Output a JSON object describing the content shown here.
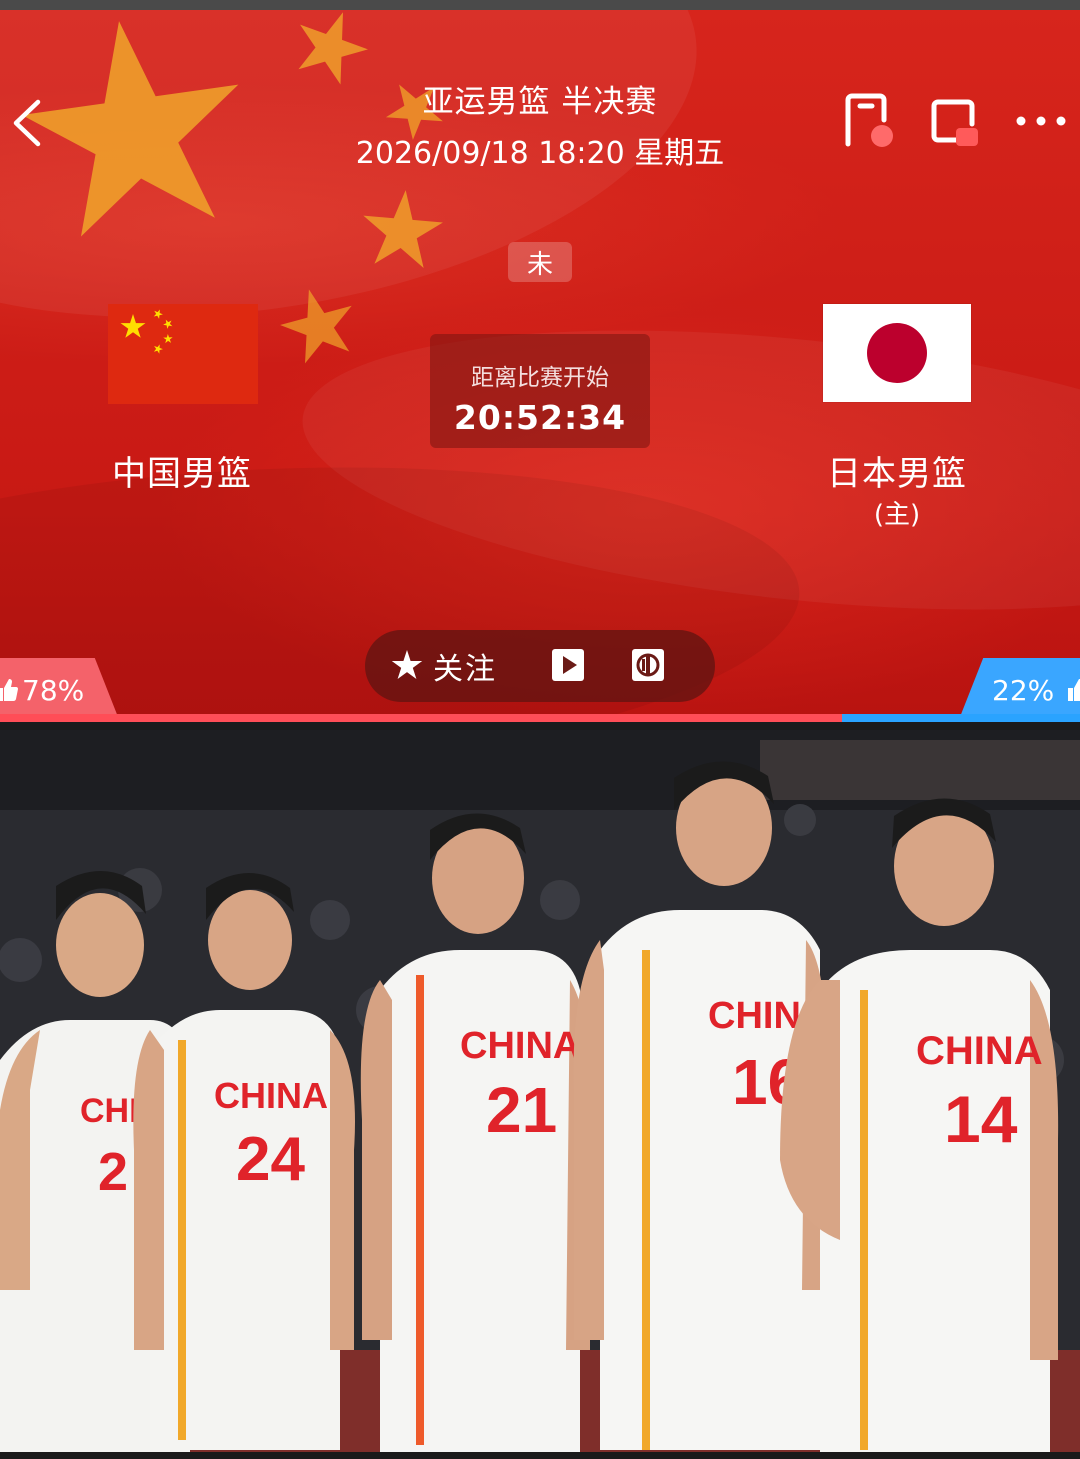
{
  "header": {
    "title": "亚运男篮 半决赛",
    "datetime": "2026/09/18 18:20 星期五",
    "status_badge": "未",
    "countdown_label": "距离比赛开始",
    "countdown_value": "20:52:34"
  },
  "teams": {
    "home": {
      "name": "中国男篮",
      "flag": "china-flag"
    },
    "away": {
      "name": "日本男篮",
      "tag": "(主)",
      "flag": "japan-flag"
    }
  },
  "actions": {
    "follow_label": "关注",
    "follow_icon": "star-icon",
    "video_icon": "play-icon",
    "stats_icon": "stats-icon"
  },
  "support": {
    "home_percent": "78%",
    "away_percent": "22%",
    "home_fraction": 0.78,
    "away_fraction": 0.22,
    "home_color": "#ff4d57",
    "away_color": "#2aa3ff"
  },
  "photo": {
    "players": [
      {
        "jersey_text": "CHI",
        "number": "2"
      },
      {
        "jersey_text": "CHINA",
        "number": "24"
      },
      {
        "jersey_text": "CHINA",
        "number": "21"
      },
      {
        "jersey_text": "CHINA",
        "number": "16"
      },
      {
        "jersey_text": "CHINA",
        "number": "14"
      }
    ]
  },
  "colors": {
    "header_red": "#d7251c",
    "jersey_red": "#e0232a"
  }
}
